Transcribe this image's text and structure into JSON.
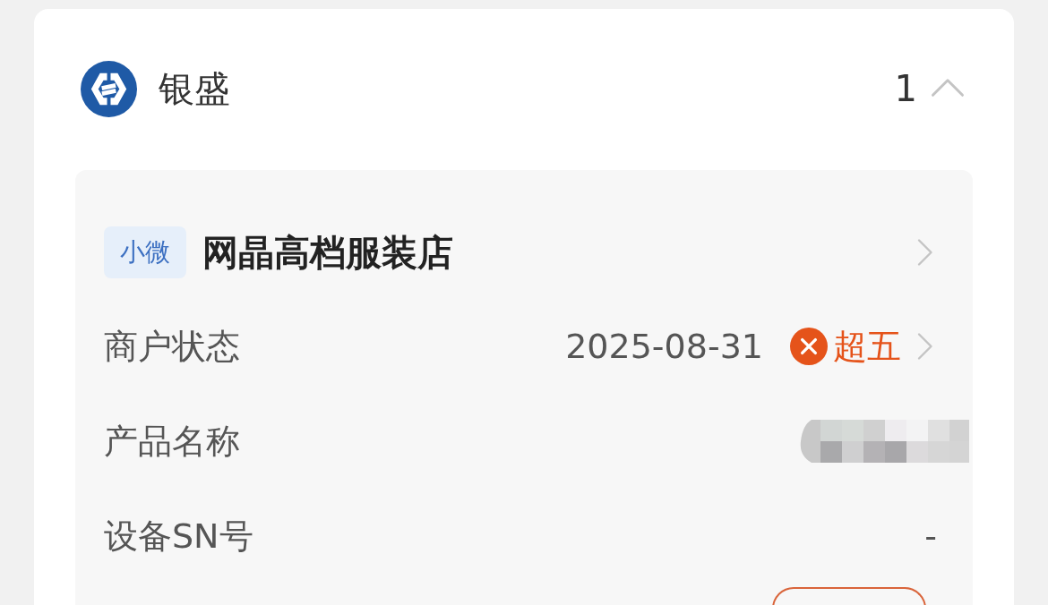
{
  "bank": {
    "name": "银盛",
    "count": "1",
    "expanded": true
  },
  "merchant": {
    "tag": "小微",
    "name": "网晶高档服装店"
  },
  "fields": [
    {
      "kind": "status",
      "label": "商户状态",
      "date": "2025-08-31",
      "status": "超五",
      "color": "#e5531a"
    },
    {
      "kind": "redacted",
      "label": "产品名称"
    },
    {
      "kind": "text",
      "label": "设备SN号",
      "value": "-"
    }
  ]
}
